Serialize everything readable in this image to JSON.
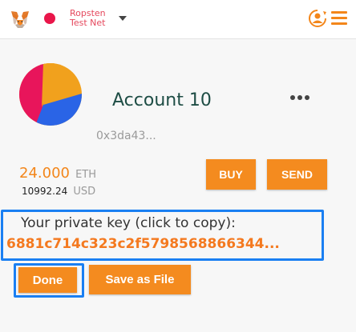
{
  "network": {
    "name": "Ropsten Test Net",
    "dot_color": "#e9164a"
  },
  "account": {
    "name": "Account 10",
    "address": "0x3da43...",
    "balance_eth": "24.000",
    "eth_unit": "ETH",
    "balance_usd": "10992.24",
    "usd_unit": "USD"
  },
  "actions": {
    "buy": "BUY",
    "send": "SEND"
  },
  "private_key": {
    "label": "Your private key (click to copy):",
    "value": "6881c714c323c2f5798568866344..."
  },
  "footer": {
    "done": "Done",
    "save": "Save as File"
  },
  "colors": {
    "accent": "#f48b1f",
    "focus": "#1a7ff2",
    "account_text": "#1e4d45"
  }
}
